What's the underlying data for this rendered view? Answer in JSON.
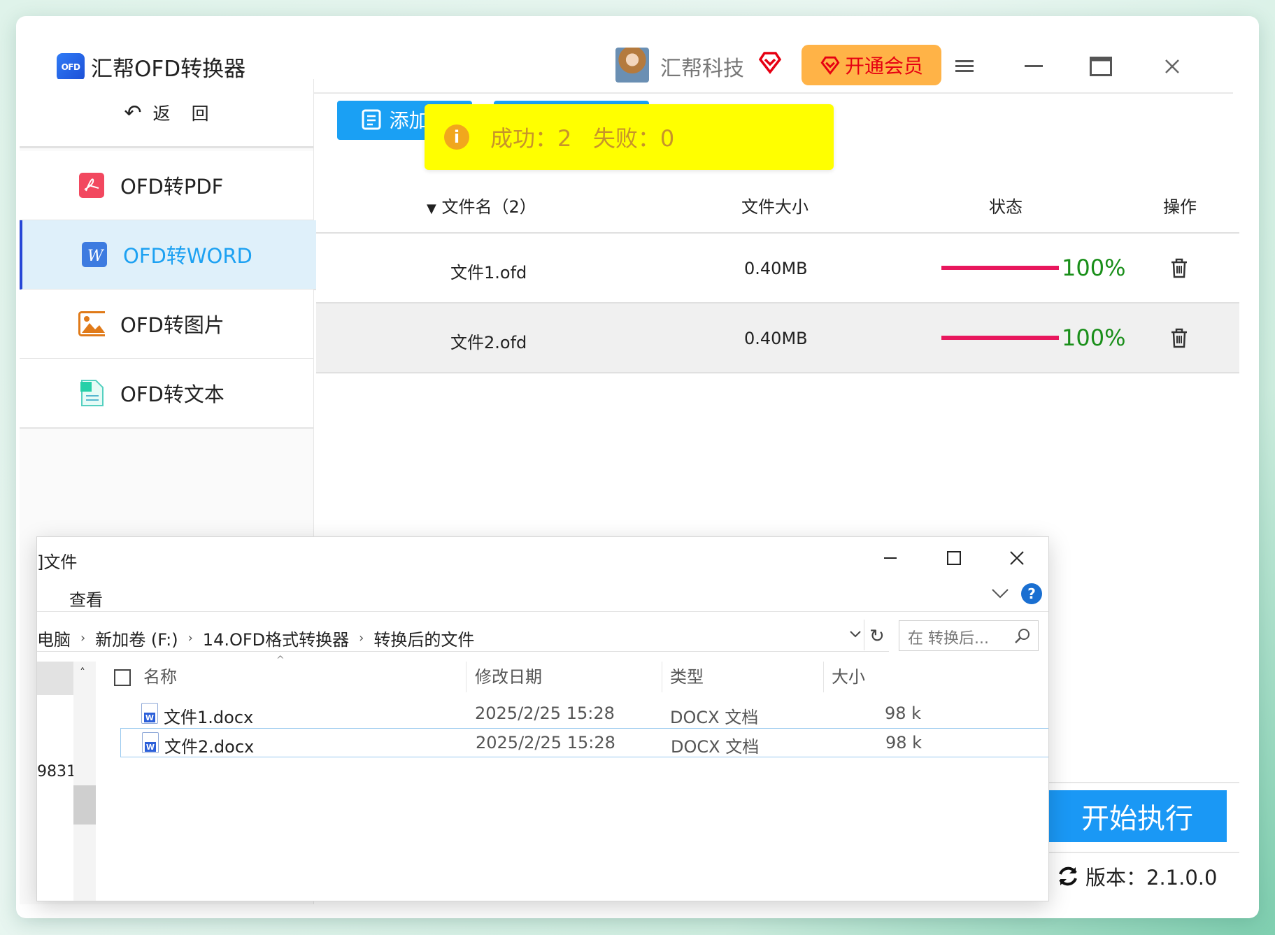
{
  "app": {
    "title": "汇帮OFD转换器",
    "logo_text": "OFD",
    "username": "汇帮科技",
    "vip_button": "开通会员",
    "accent_color": "#1aa0f4"
  },
  "sidebar": {
    "back": {
      "arrow": "↶",
      "label1": "返",
      "label2": "回"
    },
    "items": [
      {
        "label": "OFD转PDF",
        "icon": "pdf-icon"
      },
      {
        "label": "OFD转WORD",
        "icon": "word-icon",
        "active": true
      },
      {
        "label": "OFD转图片",
        "icon": "image-icon"
      },
      {
        "label": "OFD转文本",
        "icon": "text-icon"
      }
    ]
  },
  "toolbar": {
    "add_file_label": "添加文"
  },
  "toast": {
    "message": "成功：2   失败：0"
  },
  "table": {
    "headers": {
      "name": "文件名（2）",
      "size": "文件大小",
      "status": "状态",
      "action": "操作"
    },
    "rows": [
      {
        "name": "文件1.ofd",
        "size": "0.40MB",
        "progress": "100%"
      },
      {
        "name": "文件2.ofd",
        "size": "0.40MB",
        "progress": "100%"
      }
    ]
  },
  "start_button": "开始执行",
  "version": "版本：2.1.0.0",
  "explorer": {
    "title": "]文件",
    "menu_view": "查看",
    "breadcrumb": [
      "电脑",
      "新加卷 (F:)",
      "14.OFD格式转换器",
      "转换后的文件"
    ],
    "search_placeholder": "在 转换后...",
    "columns": {
      "name": "名称",
      "date": "修改日期",
      "type": "类型",
      "size": "大小"
    },
    "files": [
      {
        "name": "文件1.docx",
        "date": "2025/2/25 15:28",
        "type": "DOCX 文档",
        "size": "98 k"
      },
      {
        "name": "文件2.docx",
        "date": "2025/2/25 15:28",
        "type": "DOCX 文档",
        "size": "98 k"
      }
    ],
    "left_pane_text": "9831"
  }
}
